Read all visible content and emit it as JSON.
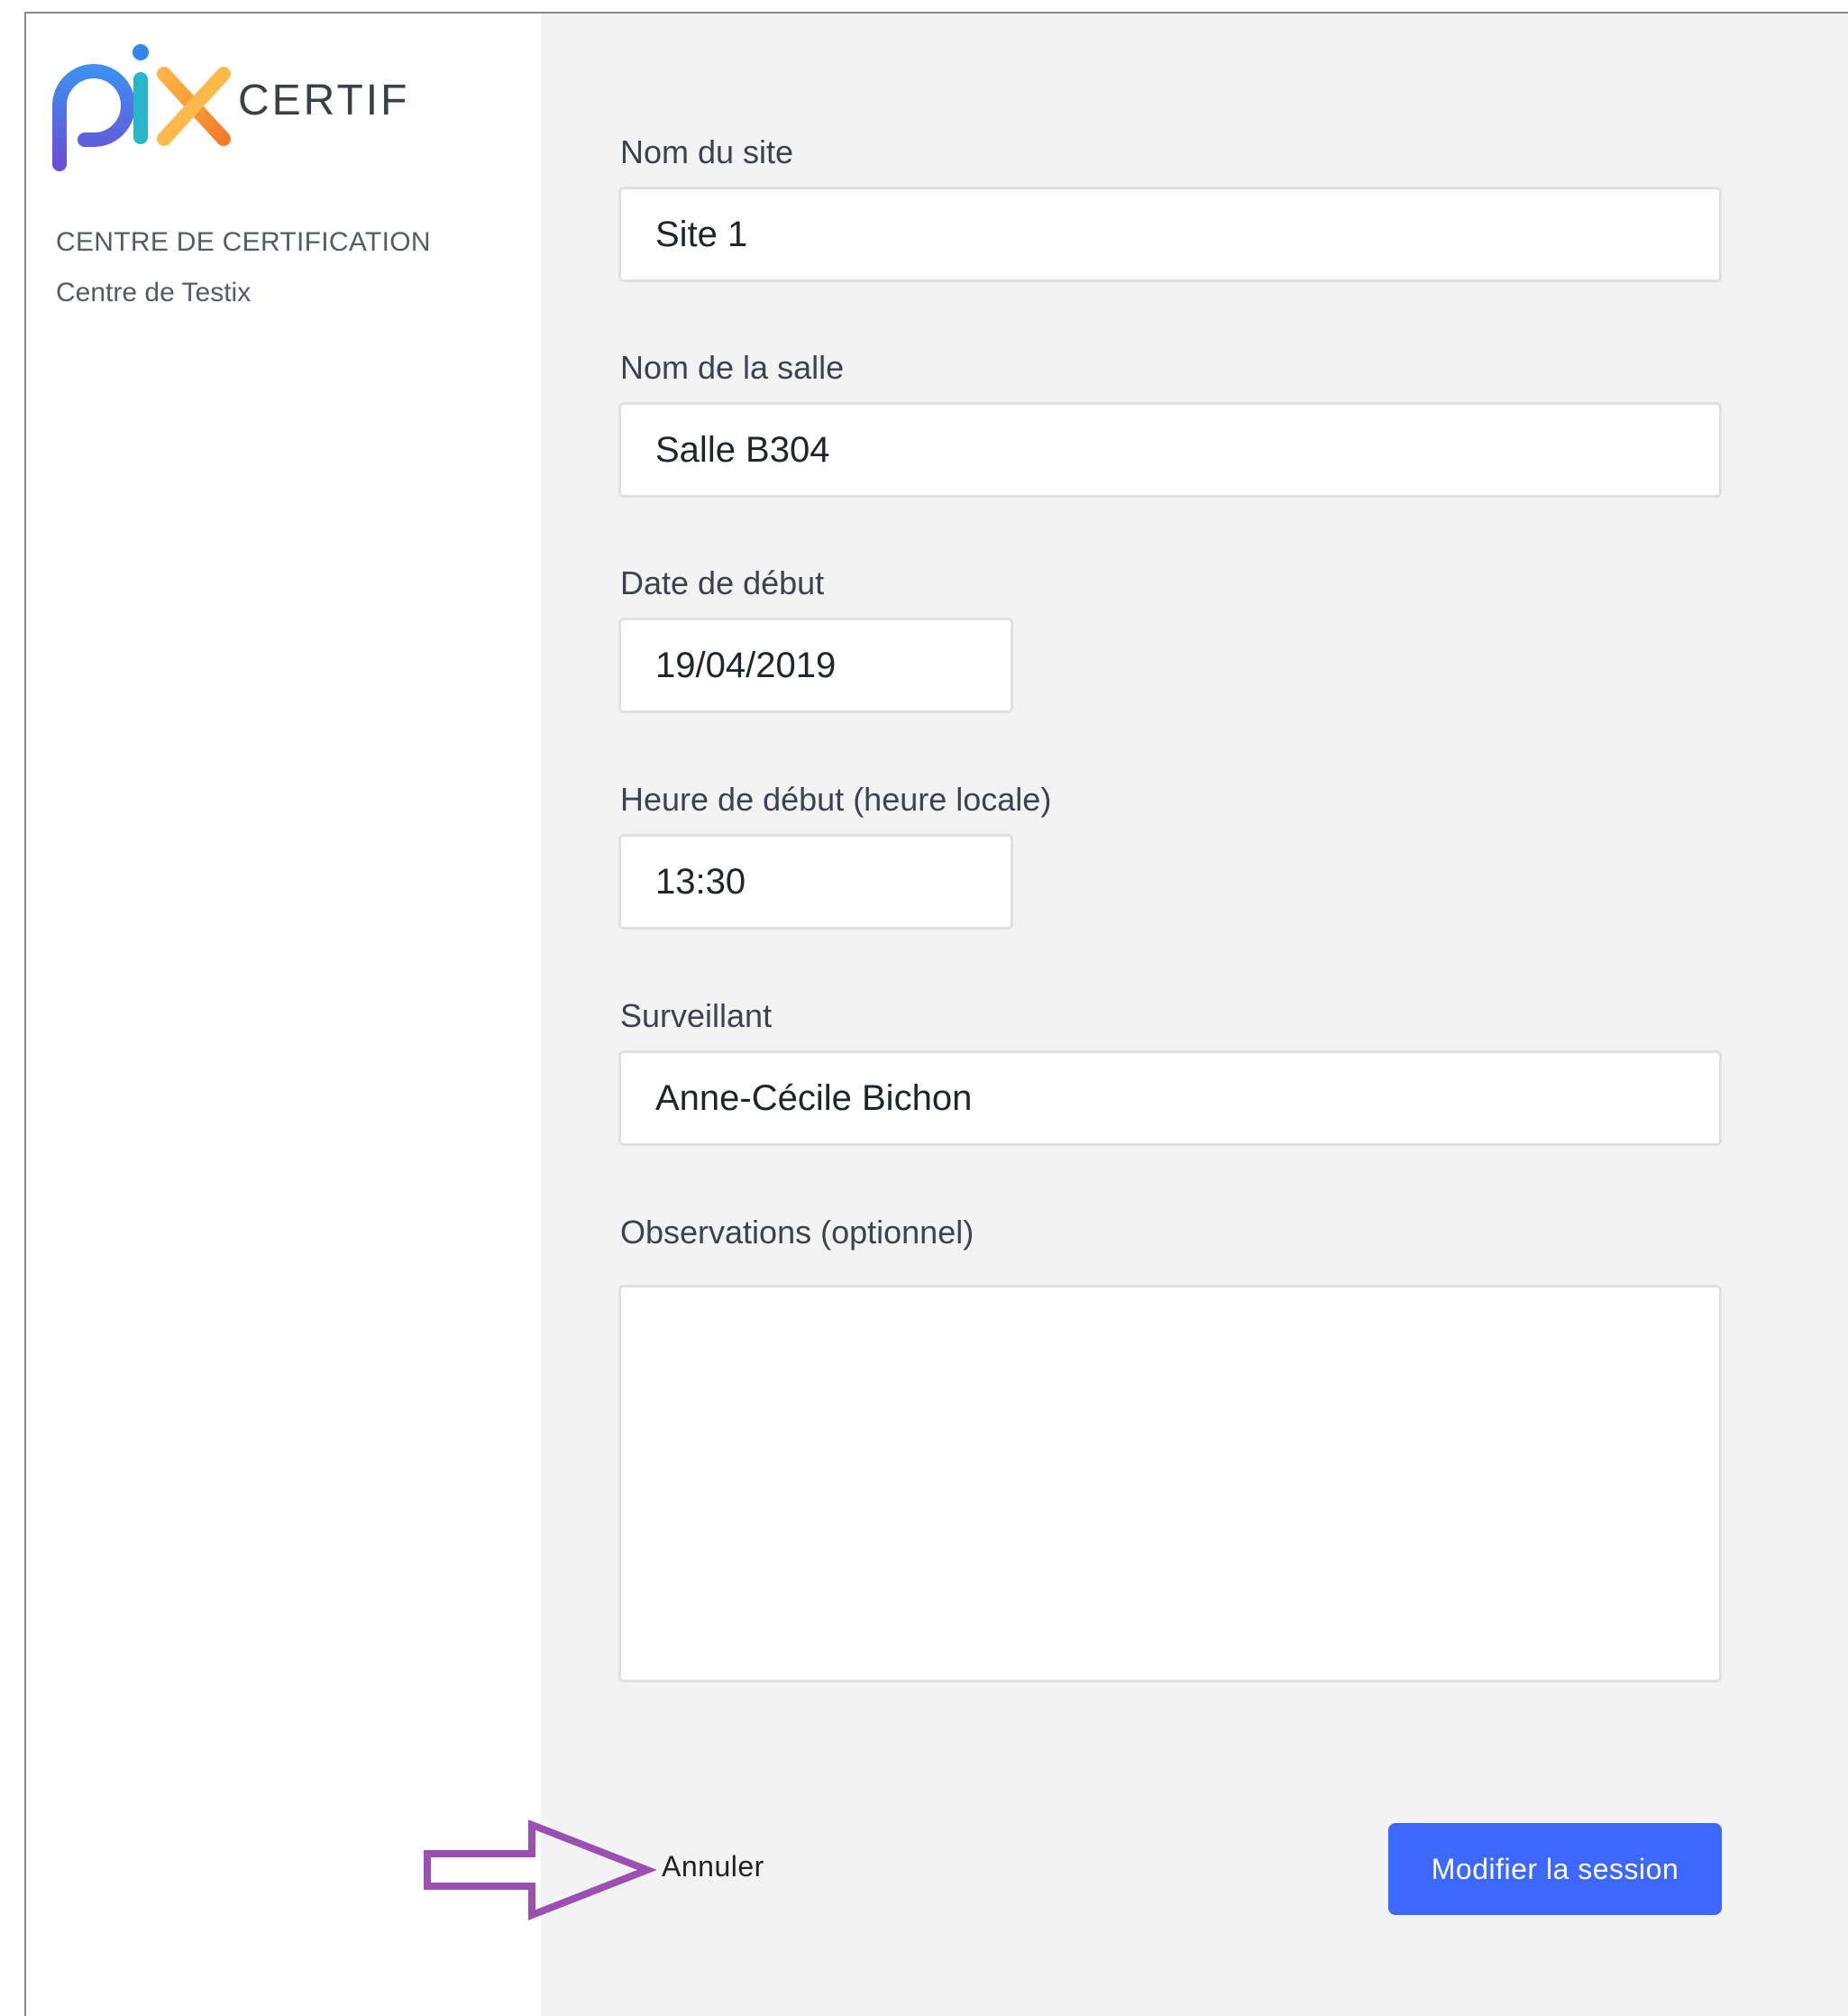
{
  "brand": {
    "logo_text": "pix",
    "product": "CERTIF"
  },
  "sidebar": {
    "heading": "CENTRE DE CERTIFICATION",
    "center_name": "Centre de Testix"
  },
  "form": {
    "site": {
      "label": "Nom du site",
      "value": "Site 1"
    },
    "room": {
      "label": "Nom de la salle",
      "value": "Salle B304"
    },
    "date": {
      "label": "Date de début",
      "value": "19/04/2019"
    },
    "time": {
      "label": "Heure de début (heure locale)",
      "value": "13:30"
    },
    "examiner": {
      "label": "Surveillant",
      "value": "Anne-Cécile Bichon"
    },
    "observations": {
      "label": "Observations (optionnel)",
      "value": ""
    }
  },
  "actions": {
    "cancel_label": "Annuler",
    "submit_label": "Modifier la session"
  },
  "colors": {
    "primary": "#3d68ff",
    "annotation_arrow": "#9b4fb3",
    "main_background": "#f3f3f3"
  }
}
